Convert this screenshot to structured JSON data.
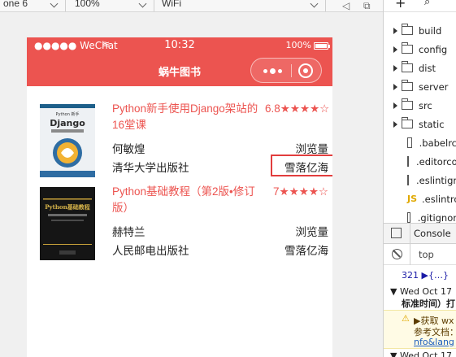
{
  "toolbar": {
    "device": "one 6",
    "zoom": "100%",
    "network": "WiFi"
  },
  "phone": {
    "status": {
      "carrier": "●●●●● WeChat",
      "time": "10:32",
      "battery": "100%"
    },
    "nav_title": "蜗牛图书",
    "books": [
      {
        "title": "Python新手使用Django架站的16堂课",
        "rating": "6.8★★★★☆",
        "author": "何敏煌",
        "views_label": "浏览量",
        "publisher": "清华大学出版社",
        "uploader": "雪落亿海",
        "cover_brand": "Django",
        "cover_tag": "Python 新手"
      },
      {
        "title": "Python基础教程（第2版•修订版）",
        "rating": "7★★★★☆",
        "author": "赫特兰",
        "views_label": "浏览量",
        "publisher": "人民邮电出版社",
        "uploader": "雪落亿海",
        "cover_brand": "Python基础教程"
      }
    ]
  },
  "devtools": {
    "tree": [
      {
        "type": "folder",
        "label": "build"
      },
      {
        "type": "folder",
        "label": "config"
      },
      {
        "type": "folder",
        "label": "dist"
      },
      {
        "type": "folder",
        "label": "server"
      },
      {
        "type": "folder",
        "label": "src"
      },
      {
        "type": "folder",
        "label": "static"
      },
      {
        "type": "file",
        "label": ".babelrc"
      },
      {
        "type": "file",
        "label": ".editorco"
      },
      {
        "type": "file",
        "label": ".eslintign"
      },
      {
        "type": "js",
        "label": ".eslintrc"
      },
      {
        "type": "file",
        "label": ".gitignor"
      }
    ],
    "console_tab": "Console",
    "filter_context": "top",
    "log1": "321 ▶{…}",
    "log2_date": "▼ Wed Oct 17",
    "log2_text": "标准时间）打",
    "log3_warn": "▶获取 wx",
    "log3_text": "参考文档：",
    "log3_link": "nfo&lang",
    "log4": "▼ Wed Oct 17"
  }
}
